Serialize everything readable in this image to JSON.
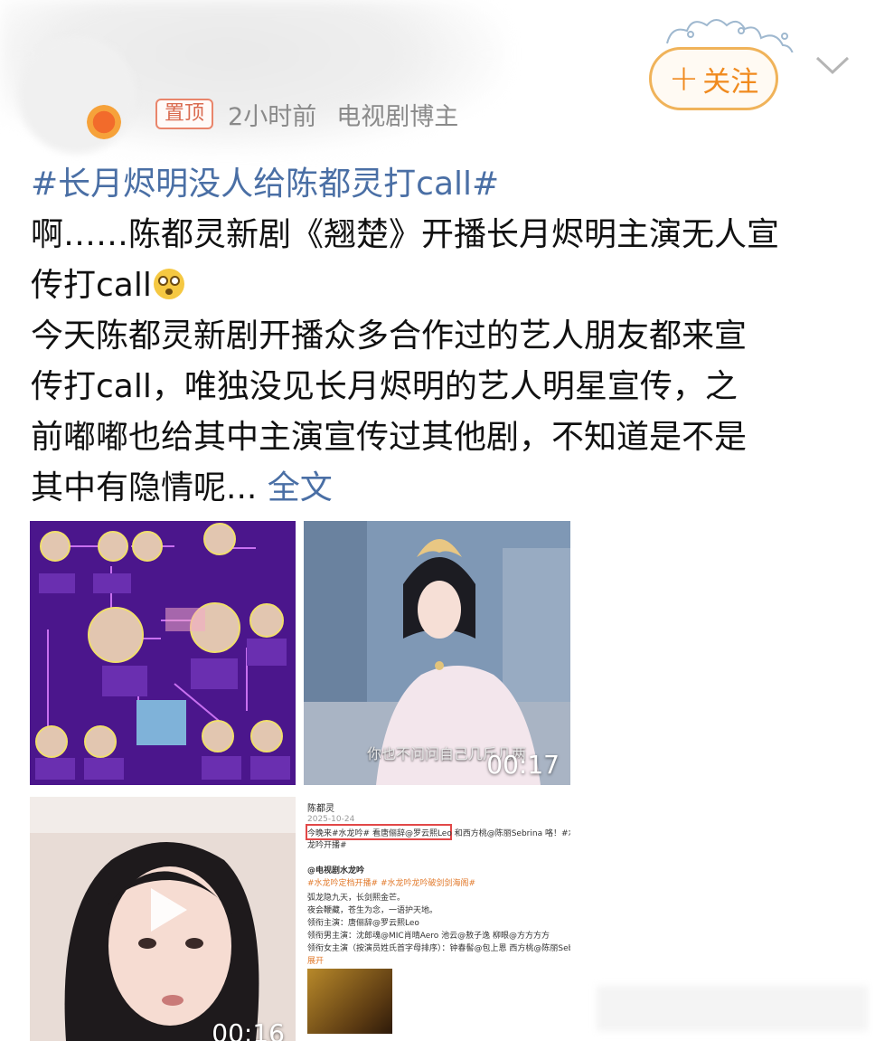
{
  "header": {
    "pin_label": "置顶",
    "time": "2小时前",
    "source": "电视剧博主",
    "follow_label": "关注",
    "follow_plus": "+",
    "follow_color": "#f08a1e"
  },
  "post": {
    "topic": "#长月烬明没人给陈都灵打call#",
    "line1": "啊……陈都灵新剧《翘楚》开播长月烬明主演无人宣",
    "line2": "传打call",
    "line3": "今天陈都灵新剧开播众多合作过的艺人朋友都来宣",
    "line4": "传打call，唯独没见长月烬明的艺人明星宣传，之",
    "line5": "前嘟嘟也给其中主演宣传过其他剧，不知道是不是",
    "line6": "其中有隐情呢...",
    "fulltext_label": "全文",
    "link_color": "#4a6fa5"
  },
  "media": {
    "video1": {
      "duration": "00:17",
      "caption": "你也不问问自己几斤几两"
    },
    "video2": {
      "duration": "00:16"
    },
    "screenshot": {
      "author": "陈都灵",
      "date": "2025-10-24",
      "row1": "今晚来#水龙吟# 看唐俪辞@罗云熙Leo 和西方桃@陈丽Sebrina 咯！#水",
      "row2": "龙吟开播#",
      "repost_author": "@电视剧水龙吟",
      "tags": "#水龙吟定档开播# #水龙吟龙吟破剑剑海阁#",
      "p1": "弧龙隐九天，长剑熙金芒。",
      "p2": "夜会鞭藏，苍生为念，一语护天地。",
      "p3": "领衔主演：唐俪辞@罗云熙Leo",
      "p4": "领衔男主演：沈郎魂@MIC肖晴Aero 池云@敖子逸 柳眼@方方方方",
      "p5": "领衔女主演（按演员姓氏首字母排序）：钟春髻@包上恩 西方桃@陈丽Sebrina",
      "p6": "展开"
    }
  }
}
